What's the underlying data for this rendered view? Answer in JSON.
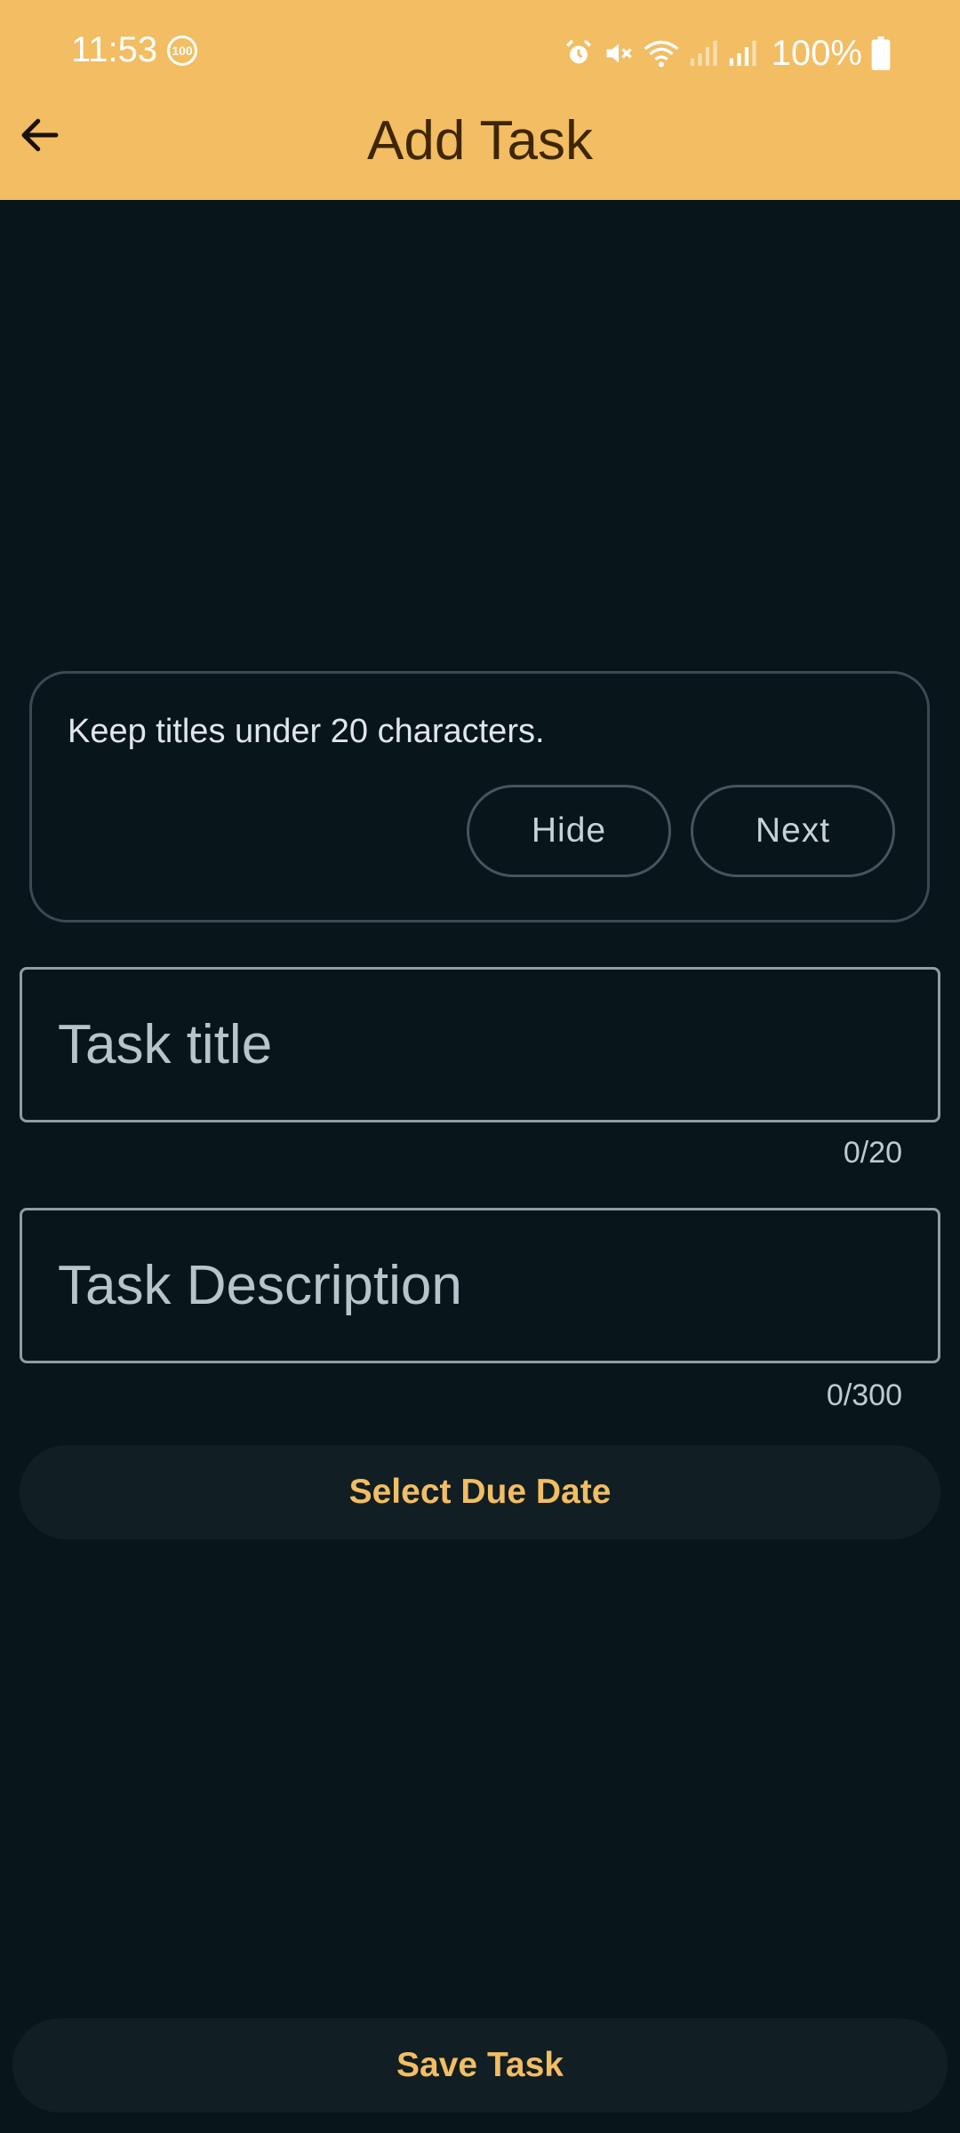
{
  "status_bar": {
    "time": "11:53",
    "badge": "100",
    "battery": "100%",
    "icons": [
      "alarm-icon",
      "mute-icon",
      "wifi-icon",
      "signal-icon",
      "signal-icon",
      "battery-icon"
    ]
  },
  "app_bar": {
    "title": "Add Task",
    "back_icon": "arrow-back-icon",
    "background_color": "#f2bd63"
  },
  "hint_card": {
    "text": "Keep titles under 20 characters.",
    "hide_label": "Hide",
    "next_label": "Next"
  },
  "form": {
    "title_field": {
      "placeholder": "Task title",
      "value": "",
      "counter": "0/20"
    },
    "description_field": {
      "placeholder": "Task Description",
      "value": "",
      "counter": "0/300"
    },
    "due_date_label": "Select Due Date",
    "save_label": "Save Task"
  },
  "colors": {
    "accent": "#f2bd63",
    "background": "#08151b",
    "surface": "#111e23"
  }
}
